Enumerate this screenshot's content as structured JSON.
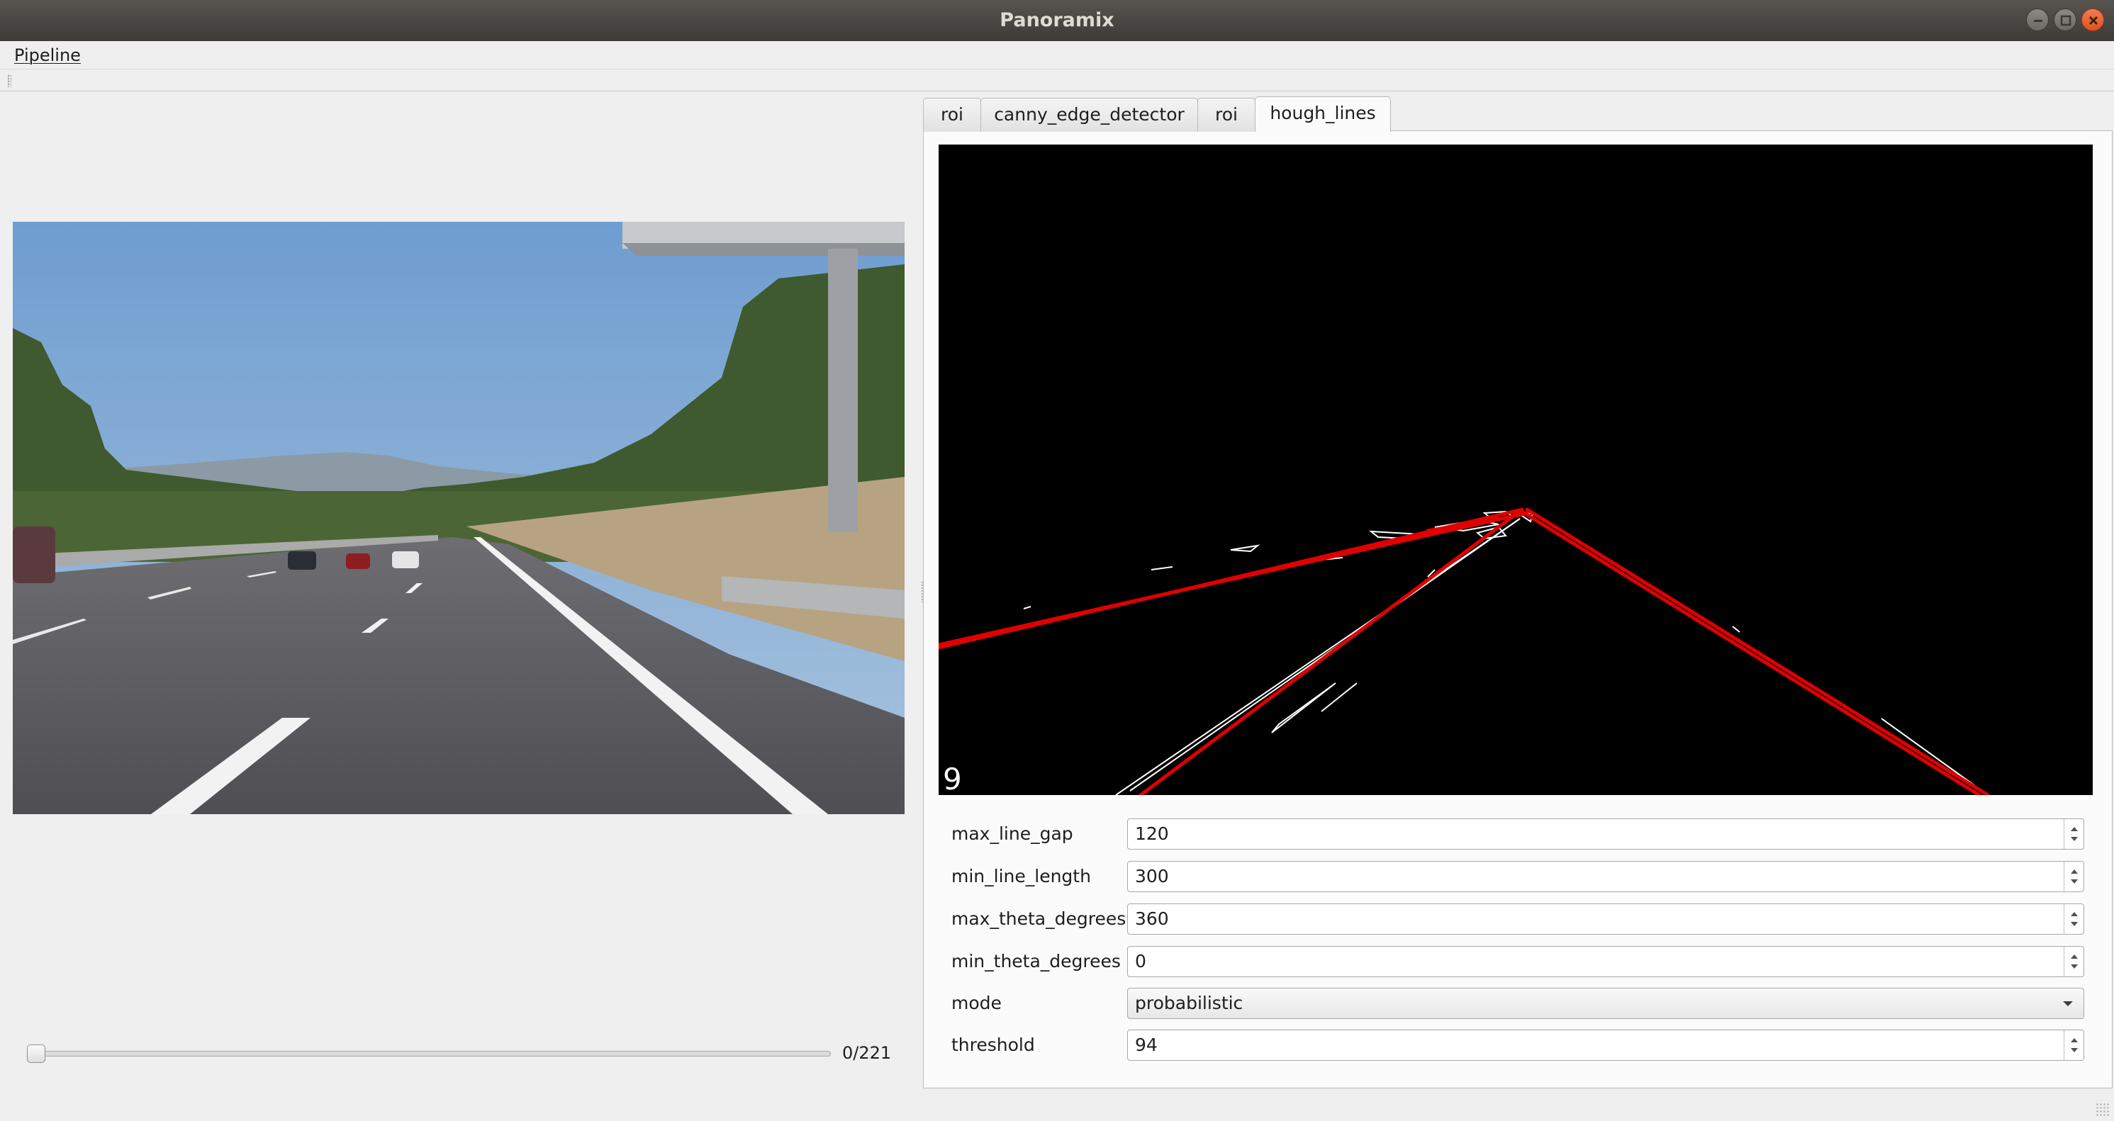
{
  "window": {
    "title": "Panoramix"
  },
  "menubar": {
    "items": [
      {
        "label": "Pipeline"
      }
    ]
  },
  "tabs": [
    {
      "label": "roi",
      "active": false
    },
    {
      "label": "canny_edge_detector",
      "active": false
    },
    {
      "label": "roi",
      "active": false
    },
    {
      "label": "hough_lines",
      "active": true
    }
  ],
  "preview": {
    "overlay_number": "9"
  },
  "params": [
    {
      "label": "max_line_gap",
      "value": "120",
      "kind": "spinbox"
    },
    {
      "label": "min_line_length",
      "value": "300",
      "kind": "spinbox"
    },
    {
      "label": "max_theta_degrees",
      "value": "360",
      "kind": "spinbox"
    },
    {
      "label": "min_theta_degrees",
      "value": "0",
      "kind": "spinbox"
    },
    {
      "label": "mode",
      "value": "probabilistic",
      "kind": "combobox"
    },
    {
      "label": "threshold",
      "value": "94",
      "kind": "spinbox"
    }
  ],
  "player": {
    "frame_counter": "0/221",
    "position_fraction": 0
  },
  "colors": {
    "line_overlay": "#e00000",
    "sky": "#7ea6d3",
    "road": "#5f5f63"
  },
  "icons": {
    "minimize": "minimize-icon",
    "maximize": "maximize-icon",
    "close": "close-icon"
  }
}
